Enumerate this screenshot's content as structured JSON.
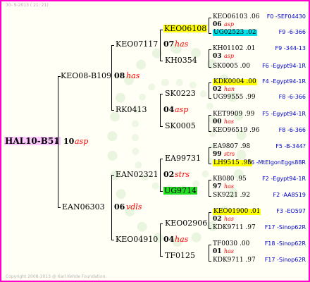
{
  "header": {
    "date": "30-  9-2013 ( 21: 21)"
  },
  "footer": {
    "copyright": "Copyright 2008-2013 @ Karl Kehde Foundation."
  },
  "tree": {
    "root": {
      "name": "HAL10-B51",
      "gen": "10",
      "label": "asp"
    },
    "sire": {
      "name": "KEO08-B109",
      "gen": "08",
      "label": "has"
    },
    "dam": {
      "name": "EAN06303",
      "gen": "06",
      "label": "vdls"
    },
    "ss": {
      "name": "KEO07117",
      "gen": "07",
      "label": "has"
    },
    "sd": {
      "name": "RK0413",
      "gen": "04",
      "label": "asp"
    },
    "ds": {
      "name": "EAN02321",
      "gen": "02",
      "label": "strs"
    },
    "dd": {
      "name": "KEO04910",
      "gen": "04",
      "label": "has"
    },
    "sss": {
      "name": "KEO06108"
    },
    "ssd": {
      "name": "KH0354"
    },
    "sds": {
      "name": "SK0223"
    },
    "sdd": {
      "name": "SK0005"
    },
    "dss": {
      "name": "EA99731"
    },
    "dsd": {
      "name": "UG9714"
    },
    "dds": {
      "name": "KEO02906"
    },
    "ddd": {
      "name": "TF0125"
    }
  },
  "leaves": [
    {
      "name": "KEO06103 .06",
      "info": "F0 -SEF04430",
      "hl": "",
      "gen": "06",
      "label": "asp"
    },
    {
      "name": "UG02523 .02",
      "info": "F9 -6-366",
      "hl": "cyan"
    },
    {
      "name": "KH01102 .01",
      "info": "F9 -344-13",
      "hl": "",
      "gen": "03",
      "label": "asp"
    },
    {
      "name": "SK0005 .00",
      "info": "F6 -Egypt94-1R",
      "hl": ""
    },
    {
      "name": "KDK0004 .00",
      "info": "F4 -Egypt94-1R",
      "hl": "yellow",
      "gen": "02",
      "label": "han"
    },
    {
      "name": "UG99555 .99",
      "info": "F8 -6-366",
      "hl": ""
    },
    {
      "name": "KET9909 .99",
      "info": "F5 -Egypt94-1R",
      "hl": "",
      "gen": "00",
      "label": "has"
    },
    {
      "name": "KEO96519 .96",
      "info": "F8 -6-366",
      "hl": ""
    },
    {
      "name": "EA9807 .98",
      "info": "F5 -B-344?",
      "hl": "",
      "gen": "99",
      "label": "strs"
    },
    {
      "name": "LH9515 .95",
      "info": "F6 -MtElgonEggs88R",
      "hl": "yellow"
    },
    {
      "name": "KB080 .95",
      "info": "F2 -Egypt94-1R",
      "hl": "",
      "gen": "97",
      "label": "has"
    },
    {
      "name": "SK9221 .92",
      "info": "F2 -AA8519",
      "hl": ""
    },
    {
      "name": "KEO01900 .01",
      "info": "F3 -EO597",
      "hl": "yellow",
      "gen": "02",
      "label": "has"
    },
    {
      "name": "KDK9711 .97",
      "info": "F17 -Sinop62R",
      "hl": ""
    },
    {
      "name": "TF0030 .00",
      "info": "F18 -Sinop62R",
      "hl": "",
      "gen": "01",
      "label": "has"
    },
    {
      "name": "KDK9711 .97",
      "info": "F17 -Sinop62R",
      "hl": ""
    }
  ]
}
